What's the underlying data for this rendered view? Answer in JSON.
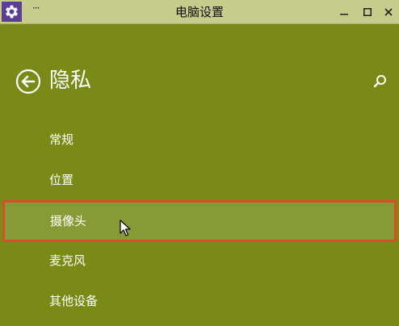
{
  "window": {
    "title": "电脑设置",
    "more_label": "···",
    "minimize_label": "—",
    "maximize_label": "☐",
    "close_label": "✕"
  },
  "header": {
    "title": "隐私"
  },
  "menu": {
    "items": [
      {
        "label": "常规"
      },
      {
        "label": "位置"
      },
      {
        "label": "摄像头",
        "selected": true
      },
      {
        "label": "麦克风"
      },
      {
        "label": "其他设备"
      }
    ]
  },
  "colors": {
    "background": "#7a8a16",
    "titlebar": "#c5cc8c",
    "app_icon": "#5b3f95",
    "selected_row": "#889a35",
    "selected_border": "#d64e2a"
  },
  "icons": {
    "app": "gear-icon",
    "back": "back-arrow-icon",
    "search": "search-icon"
  }
}
